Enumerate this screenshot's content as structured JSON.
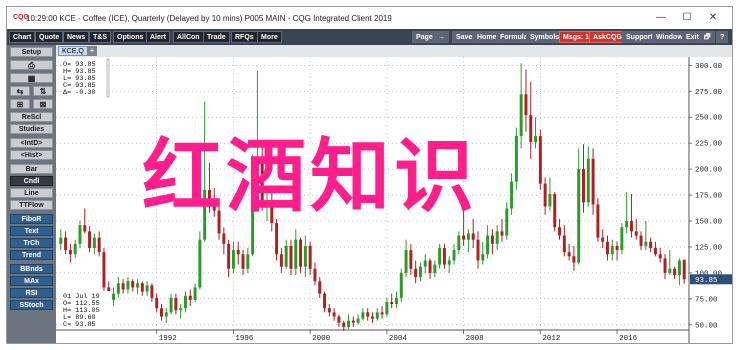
{
  "window": {
    "title": "10:29:00  KCE - Coffee (ICE), Quarterly (Delayed by 10 mins)  P005 MAIN - CQG Integrated Client 2019",
    "app_icon_label": "CQG",
    "controls": {
      "minimize": "—",
      "maximize": "☐",
      "close": "✕"
    }
  },
  "toolbar": {
    "left": [
      "Chart",
      "Quote",
      "News",
      "T&S",
      "Options",
      "Alert",
      "AllCon",
      "Trade",
      "RFQs",
      "More"
    ],
    "right": [
      {
        "label": "Page",
        "style": "light"
      },
      {
        "label": "→",
        "style": "light"
      },
      {
        "label": "Save",
        "style": "light"
      },
      {
        "label": "Home",
        "style": "light"
      },
      {
        "label": "Formula",
        "style": "light"
      },
      {
        "label": "Symbols",
        "style": "light"
      },
      {
        "label": "Msgs: 1",
        "style": "red"
      },
      {
        "label": "AskCQG",
        "style": "red"
      },
      {
        "label": "Support",
        "style": "light"
      },
      {
        "label": "Window",
        "style": "light"
      },
      {
        "label": "Exit",
        "style": "light"
      },
      {
        "label": "🗗",
        "style": "light"
      },
      {
        "label": "?",
        "style": "light"
      }
    ]
  },
  "left_panel": {
    "setup": "Setup",
    "icon_row1": "⎙",
    "icon_row2": "▦",
    "icon_row3a": "⇆",
    "icon_row3b": "⇅",
    "icon_row4a": "⊞",
    "icon_row4b": "⊠",
    "buttons": [
      {
        "label": "ReScl",
        "style": "light"
      },
      {
        "label": "Studies",
        "style": "light"
      },
      {
        "label": "<IntD>",
        "style": "light"
      },
      {
        "label": "<Hist>",
        "style": "light"
      },
      {
        "label": "Bar",
        "style": "light"
      },
      {
        "label": "Cndl",
        "style": "dark"
      },
      {
        "label": "Line",
        "style": "light"
      },
      {
        "label": "TTFlow",
        "style": "light"
      },
      {
        "label": "FiboR",
        "style": "blue"
      },
      {
        "label": "Text",
        "style": "blue"
      },
      {
        "label": "TrCh",
        "style": "blue"
      },
      {
        "label": "Trend",
        "style": "blue"
      },
      {
        "label": "BBnds",
        "style": "blue"
      },
      {
        "label": "MAx",
        "style": "blue"
      },
      {
        "label": "RSI",
        "style": "blue"
      },
      {
        "label": "SStoch",
        "style": "blue"
      }
    ]
  },
  "chart_tab": {
    "label": "KCE,Q",
    "add_label": "+"
  },
  "readout_top": [
    "O=  93.85",
    "H=  93.85",
    "L=  93.85",
    "C=  93.85",
    "Δ=  -0.30"
  ],
  "readout_bottom": [
    "01 Jul 19",
    "O=  112.55",
    "H=  113.05",
    "L=  89.60",
    "C=  93.85"
  ],
  "watermark": "红酒知识",
  "colors": {
    "up": "#2a9c2a",
    "down": "#b02020",
    "last_price_bg": "#2e4f7a"
  },
  "chart_data": {
    "type": "candlestick",
    "title": "KCE - Coffee (ICE), Quarterly",
    "xlabel": "",
    "ylabel": "",
    "ylim": [
      45,
      308
    ],
    "y_ticks": [
      50,
      75,
      100,
      125,
      150,
      175,
      200,
      225,
      250,
      275,
      300
    ],
    "y_tick_labels": [
      "50.00",
      "75.00",
      "100.00",
      "125.00",
      "150.00",
      "175.00",
      "200.00",
      "225.00",
      "250.00",
      "275.00",
      "300.00"
    ],
    "x_range": [
      1986.75,
      2019.75
    ],
    "x_ticks": [
      1992,
      1996,
      2000,
      2004,
      2008,
      2012,
      2016
    ],
    "x_tick_labels": [
      "1992",
      "1996",
      "2000",
      "2004",
      "2008",
      "2012",
      "2016"
    ],
    "last_price": 93.85,
    "last_price_label": "93.85",
    "grid": true,
    "series": [
      {
        "name": "KCE,Q",
        "ohlc": [
          [
            1987.0,
            128,
            142,
            122,
            134
          ],
          [
            1987.25,
            134,
            140,
            118,
            122
          ],
          [
            1987.5,
            122,
            128,
            110,
            118
          ],
          [
            1987.75,
            118,
            132,
            114,
            128
          ],
          [
            1988.0,
            128,
            150,
            124,
            146
          ],
          [
            1988.25,
            146,
            162,
            138,
            140
          ],
          [
            1988.5,
            140,
            145,
            120,
            124
          ],
          [
            1988.75,
            124,
            138,
            118,
            134
          ],
          [
            1989.0,
            134,
            140,
            116,
            120
          ],
          [
            1989.25,
            120,
            124,
            82,
            86
          ],
          [
            1989.5,
            86,
            92,
            70,
            74
          ],
          [
            1989.75,
            74,
            86,
            68,
            80
          ],
          [
            1990.0,
            80,
            96,
            76,
            90
          ],
          [
            1990.25,
            90,
            94,
            80,
            84
          ],
          [
            1990.5,
            84,
            96,
            80,
            92
          ],
          [
            1990.75,
            92,
            94,
            82,
            86
          ],
          [
            1991.0,
            86,
            94,
            80,
            90
          ],
          [
            1991.25,
            90,
            92,
            78,
            82
          ],
          [
            1991.5,
            82,
            92,
            78,
            88
          ],
          [
            1991.75,
            88,
            90,
            72,
            76
          ],
          [
            1992.0,
            76,
            80,
            62,
            66
          ],
          [
            1992.25,
            66,
            70,
            54,
            58
          ],
          [
            1992.5,
            58,
            66,
            52,
            62
          ],
          [
            1992.75,
            62,
            80,
            60,
            76
          ],
          [
            1993.0,
            76,
            80,
            60,
            64
          ],
          [
            1993.25,
            64,
            70,
            56,
            66
          ],
          [
            1993.5,
            66,
            82,
            62,
            78
          ],
          [
            1993.75,
            78,
            84,
            68,
            74
          ],
          [
            1994.0,
            74,
            90,
            72,
            86
          ],
          [
            1994.25,
            86,
            140,
            84,
            132
          ],
          [
            1994.5,
            132,
            265,
            130,
            180
          ],
          [
            1994.75,
            180,
            206,
            158,
            168
          ],
          [
            1995.0,
            168,
            182,
            154,
            160
          ],
          [
            1995.25,
            160,
            168,
            132,
            138
          ],
          [
            1995.5,
            138,
            144,
            118,
            128
          ],
          [
            1995.75,
            128,
            132,
            96,
            104
          ],
          [
            1996.0,
            104,
            130,
            100,
            122
          ],
          [
            1996.25,
            122,
            130,
            108,
            118
          ],
          [
            1996.5,
            118,
            122,
            98,
            104
          ],
          [
            1996.75,
            104,
            124,
            100,
            118
          ],
          [
            1997.0,
            118,
            214,
            116,
            198
          ],
          [
            1997.25,
            198,
            295,
            190,
            212
          ],
          [
            1997.5,
            212,
            222,
            160,
            166
          ],
          [
            1997.75,
            166,
            182,
            150,
            170
          ],
          [
            1998.0,
            170,
            184,
            140,
            148
          ],
          [
            1998.25,
            148,
            152,
            112,
            118
          ],
          [
            1998.5,
            118,
            124,
            100,
            106
          ],
          [
            1998.75,
            106,
            132,
            104,
            126
          ],
          [
            1999.0,
            126,
            132,
            98,
            104
          ],
          [
            1999.25,
            104,
            142,
            98,
            132
          ],
          [
            1999.5,
            132,
            134,
            100,
            106
          ],
          [
            1999.75,
            106,
            136,
            96,
            126
          ],
          [
            2000.0,
            126,
            130,
            98,
            104
          ],
          [
            2000.25,
            104,
            110,
            88,
            92
          ],
          [
            2000.5,
            92,
            96,
            76,
            80
          ],
          [
            2000.75,
            80,
            82,
            62,
            66
          ],
          [
            2001.0,
            66,
            70,
            58,
            62
          ],
          [
            2001.25,
            62,
            66,
            54,
            58
          ],
          [
            2001.5,
            58,
            60,
            48,
            52
          ],
          [
            2001.75,
            52,
            54,
            44,
            48
          ],
          [
            2002.0,
            48,
            60,
            46,
            54
          ],
          [
            2002.25,
            54,
            58,
            48,
            52
          ],
          [
            2002.5,
            52,
            60,
            50,
            56
          ],
          [
            2002.75,
            56,
            66,
            54,
            62
          ],
          [
            2003.0,
            62,
            66,
            54,
            58
          ],
          [
            2003.25,
            58,
            62,
            52,
            56
          ],
          [
            2003.5,
            56,
            66,
            54,
            62
          ],
          [
            2003.75,
            62,
            68,
            56,
            60
          ],
          [
            2004.0,
            60,
            76,
            58,
            72
          ],
          [
            2004.25,
            72,
            80,
            66,
            70
          ],
          [
            2004.5,
            70,
            82,
            66,
            76
          ],
          [
            2004.75,
            76,
            104,
            72,
            100
          ],
          [
            2005.0,
            100,
            132,
            96,
            122
          ],
          [
            2005.25,
            122,
            128,
            98,
            104
          ],
          [
            2005.5,
            104,
            112,
            90,
            96
          ],
          [
            2005.75,
            96,
            110,
            92,
            106
          ],
          [
            2006.0,
            106,
            118,
            100,
            112
          ],
          [
            2006.25,
            112,
            114,
            94,
            100
          ],
          [
            2006.5,
            100,
            112,
            96,
            108
          ],
          [
            2006.75,
            108,
            128,
            104,
            124
          ],
          [
            2007.0,
            124,
            128,
            104,
            108
          ],
          [
            2007.25,
            108,
            116,
            100,
            112
          ],
          [
            2007.5,
            112,
            128,
            108,
            122
          ],
          [
            2007.75,
            122,
            140,
            118,
            136
          ],
          [
            2008.0,
            136,
            168,
            126,
            132
          ],
          [
            2008.25,
            132,
            142,
            120,
            138
          ],
          [
            2008.5,
            138,
            152,
            124,
            132
          ],
          [
            2008.75,
            132,
            140,
            104,
            112
          ],
          [
            2009.0,
            112,
            130,
            108,
            118
          ],
          [
            2009.25,
            118,
            146,
            114,
            136
          ],
          [
            2009.5,
            136,
            142,
            118,
            128
          ],
          [
            2009.75,
            128,
            146,
            122,
            140
          ],
          [
            2010.0,
            140,
            152,
            130,
            136
          ],
          [
            2010.25,
            136,
            168,
            132,
            162
          ],
          [
            2010.5,
            162,
            196,
            156,
            188
          ],
          [
            2010.75,
            188,
            240,
            180,
            232
          ],
          [
            2011.0,
            232,
            302,
            220,
            272
          ],
          [
            2011.25,
            272,
            296,
            236,
            252
          ],
          [
            2011.5,
            252,
            284,
            210,
            226
          ],
          [
            2011.75,
            226,
            250,
            220,
            232
          ],
          [
            2012.0,
            232,
            238,
            180,
            186
          ],
          [
            2012.25,
            186,
            192,
            156,
            164
          ],
          [
            2012.5,
            164,
            192,
            160,
            176
          ],
          [
            2012.75,
            176,
            178,
            140,
            144
          ],
          [
            2013.0,
            144,
            152,
            132,
            136
          ],
          [
            2013.25,
            136,
            146,
            116,
            120
          ],
          [
            2013.5,
            120,
            128,
            112,
            116
          ],
          [
            2013.75,
            116,
            126,
            102,
            110
          ],
          [
            2014.0,
            110,
            220,
            108,
            200
          ],
          [
            2014.25,
            200,
            224,
            158,
            168
          ],
          [
            2014.5,
            168,
            222,
            164,
            210
          ],
          [
            2014.75,
            210,
            220,
            156,
            166
          ],
          [
            2015.0,
            166,
            172,
            130,
            134
          ],
          [
            2015.25,
            134,
            142,
            124,
            130
          ],
          [
            2015.5,
            130,
            136,
            112,
            118
          ],
          [
            2015.75,
            118,
            132,
            112,
            126
          ],
          [
            2016.0,
            126,
            130,
            112,
            122
          ],
          [
            2016.25,
            122,
            148,
            118,
            144
          ],
          [
            2016.5,
            144,
            178,
            138,
            150
          ],
          [
            2016.75,
            150,
            176,
            134,
            140
          ],
          [
            2017.0,
            140,
            152,
            132,
            136
          ],
          [
            2017.25,
            136,
            140,
            122,
            126
          ],
          [
            2017.5,
            126,
            150,
            122,
            130
          ],
          [
            2017.75,
            130,
            134,
            120,
            124
          ],
          [
            2018.0,
            124,
            130,
            116,
            118
          ],
          [
            2018.25,
            118,
            124,
            110,
            114
          ],
          [
            2018.5,
            114,
            118,
            94,
            100
          ],
          [
            2018.75,
            100,
            122,
            98,
            104
          ],
          [
            2019.0,
            104,
            106,
            94,
            98
          ],
          [
            2019.25,
            98,
            114,
            88,
            112
          ],
          [
            2019.5,
            112.55,
            113.05,
            89.6,
            93.85
          ]
        ]
      }
    ]
  }
}
